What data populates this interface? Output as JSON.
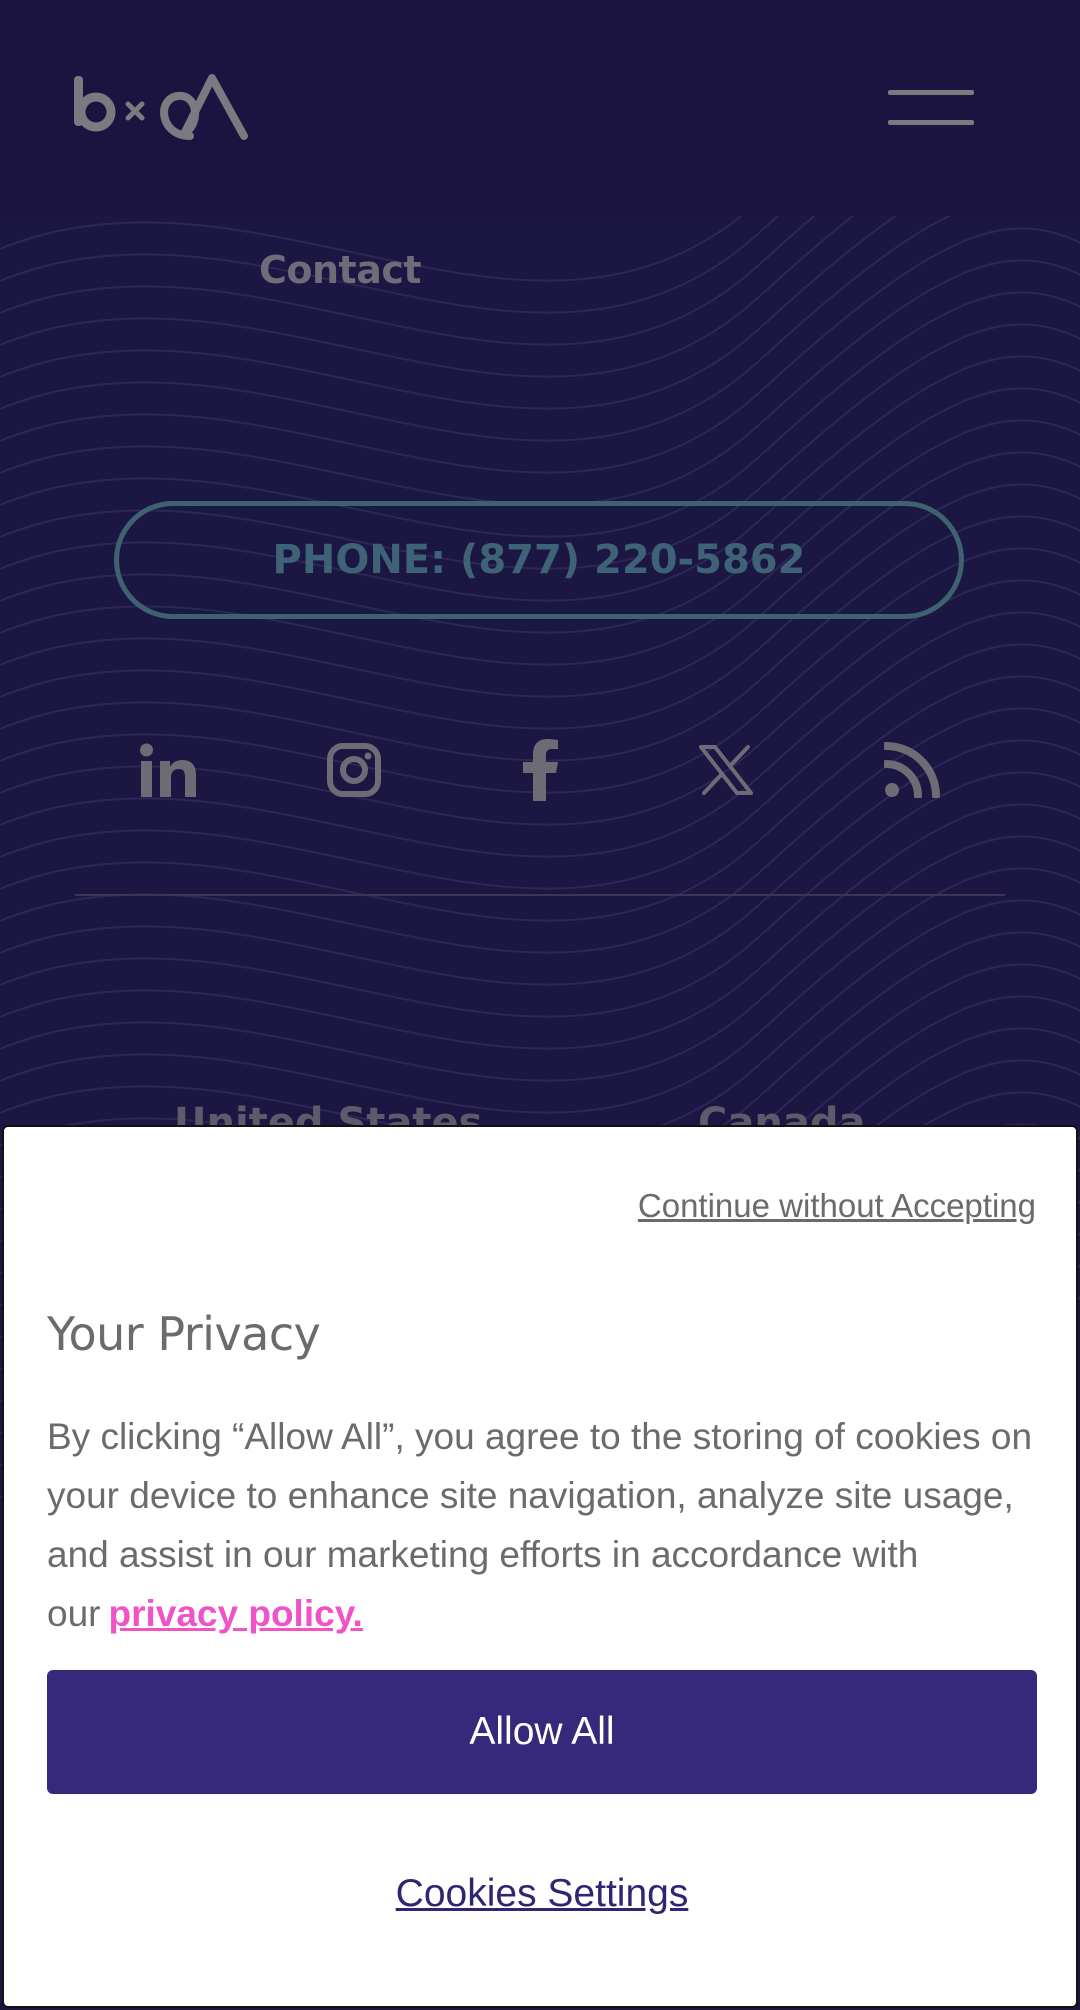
{
  "brand": {
    "logo_text": "b×A"
  },
  "header": {
    "menu_icon": "hamburger-menu-icon"
  },
  "nav": {
    "contact_label": "Contact"
  },
  "phone": {
    "label": "PHONE: (877) 220-5862"
  },
  "social": [
    {
      "name": "linkedin",
      "icon": "linkedin-icon"
    },
    {
      "name": "instagram",
      "icon": "instagram-icon"
    },
    {
      "name": "facebook",
      "icon": "facebook-icon"
    },
    {
      "name": "x",
      "icon": "x-icon"
    },
    {
      "name": "rss",
      "icon": "rss-icon"
    }
  ],
  "regions": {
    "left": "United States",
    "right": "Canada"
  },
  "cookie_banner": {
    "continue_label": "Continue without Accepting",
    "title": "Your Privacy",
    "body": "By clicking “Allow All”, you agree to the storing of cookies on your device to enhance site navigation, analyze site usage, and assist in our marketing efforts in accordance with our",
    "policy_link": "privacy policy.",
    "allow_label": "Allow All",
    "settings_label": "Cookies Settings"
  },
  "colors": {
    "background": "#1c1642",
    "accent": "#36297b",
    "link_pink": "#f052c8",
    "phone_border": "#3e6271"
  }
}
